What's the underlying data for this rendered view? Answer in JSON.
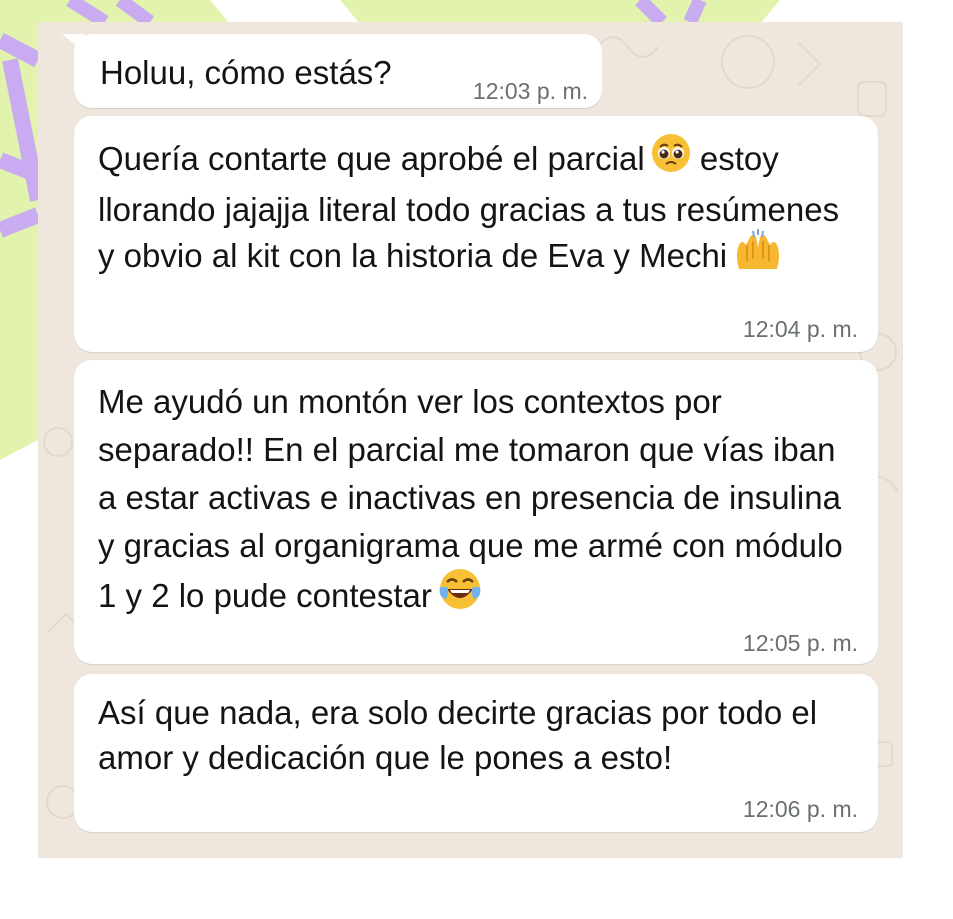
{
  "colors": {
    "chat_background": "#efe7dd",
    "bubble_background": "#ffffff",
    "message_text": "#141414",
    "timestamp_text": "#6a6f72",
    "decor_lime": "#e1f3ad",
    "decor_lavender": "#c9abf2"
  },
  "messages": [
    {
      "text": "Holuu, cómo estás?",
      "time": "12:03 p. m."
    },
    {
      "text_before_emoji": "Quería contarte que aprobé el parcial",
      "emoji": "pleading-face",
      "text_after_emoji": " estoy llorando jajajja literal todo gracias a tus resúmenes y obvio al kit con la historia de Eva y Mechi",
      "end_emoji": "raising-hands",
      "time": "12:04 p. m."
    },
    {
      "text": "Me ayudó un montón ver los contextos por separado!! En el parcial me tomaron que vías iban a estar activas e inactivas en presencia de insulina y gracias al organigrama que me armé con módulo 1 y 2 lo pude contestar",
      "end_emoji": "face-with-tears-of-joy",
      "time": "12:05 p. m."
    },
    {
      "text": "Así que nada, era solo decirte gracias por todo el amor y dedicación que le pones a esto!",
      "time": "12:06 p. m."
    }
  ]
}
